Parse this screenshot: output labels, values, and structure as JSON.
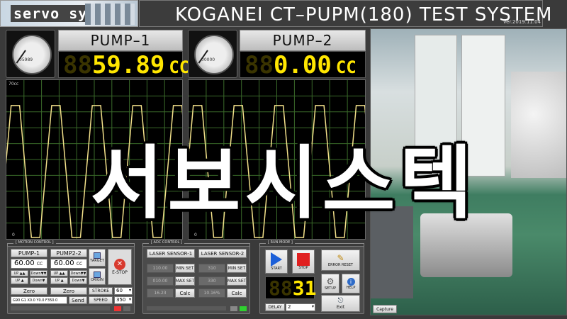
{
  "header": {
    "logo_text": "servo systec",
    "title": "KOGANEI CT–PUPM(180) TEST SYSTEM",
    "version": "Ver.2019.11.04"
  },
  "pump1": {
    "title": "PUMP–1",
    "ghost": "88",
    "value": "59.89",
    "unit": "CC",
    "gauge_reading": "05989",
    "scope_top": "70cc",
    "scope_bottom": "0"
  },
  "pump2": {
    "title": "PUMP–2",
    "ghost": "88",
    "value": "0.00",
    "unit": "CC",
    "gauge_reading": "00000",
    "scope_bottom": "0"
  },
  "motion": {
    "group_label": "[ MOTION CONTROL ]",
    "pump1_label": "PUMP-1",
    "pump2_label": "PUMP2-2",
    "pump1_value": "60.00",
    "pump2_value": "60.00",
    "unit": "CC",
    "up_fast": "UP ▲▲",
    "down_fast": "Down▼▼",
    "up": "UP ▲",
    "down": "Down▼",
    "zero": "Zero",
    "target": "TARGET",
    "origin": "ORIGIN",
    "estop": "E-STOP",
    "stroke_label": "STROKE",
    "stroke_value": "60",
    "speed_label": "SPEED",
    "speed_value": "350",
    "command": "G90 G1 X0.0 Y0.0 F350.0",
    "send": "Send"
  },
  "adc": {
    "group_label": "[ ADC CONTROL ]",
    "sensor1": "LASER SENSOR-1",
    "sensor2": "LASER SENSOR-2",
    "min_set": "MIN SET",
    "max_set": "MAX SET",
    "calc": "Calc",
    "s1_min": "110.00",
    "s1_max": "010.00",
    "s1_calc": "16.23",
    "s2_min": "310",
    "s2_max": "330",
    "s2_calc": "10.16%"
  },
  "run": {
    "group_label": "[ RUN MODE ]",
    "start": "START",
    "stop": "STOP",
    "error_reset": "ERROR RESET",
    "setup": "SETUP",
    "help": "HELP",
    "exit": "Exit",
    "ghost": "88",
    "count": "31",
    "delay_label": "DELAY",
    "delay_value": "2"
  },
  "camera": {
    "capture": "Capture"
  },
  "overlay_text": "서보시스텍",
  "colors": {
    "segment": "#ffe600",
    "scope_green": "#3a6a2a",
    "scope_trace": "#f2e08a",
    "estop": "#d83a2e",
    "start_blue": "#1c5fd8"
  }
}
